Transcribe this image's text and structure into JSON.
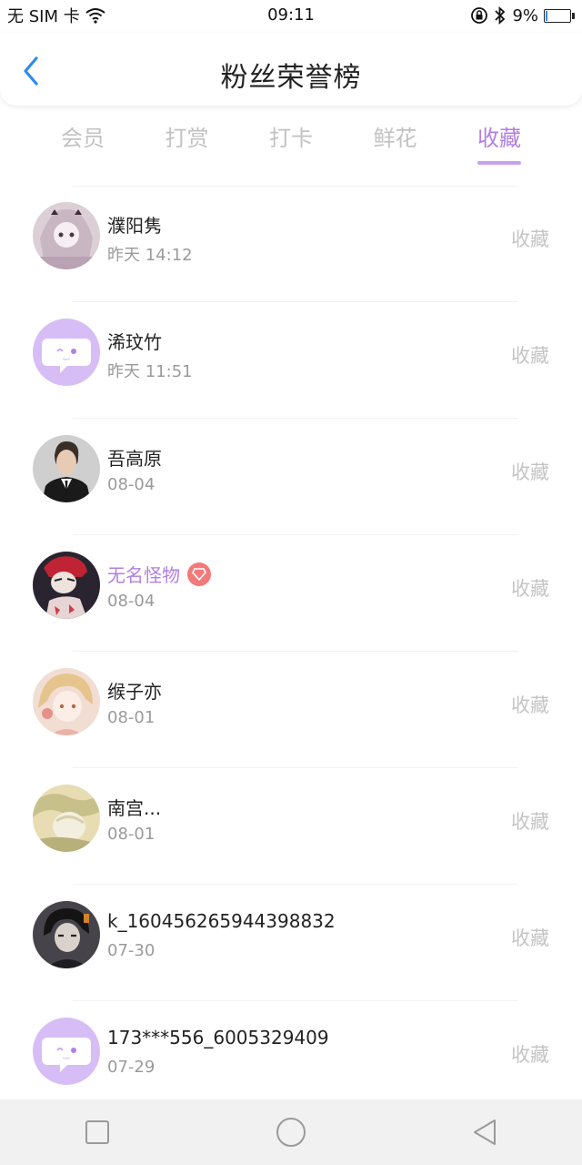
{
  "status_bar": {
    "carrier": "无 SIM 卡",
    "time": "09:11",
    "battery": "9%",
    "battery_level": 0.09,
    "icons": [
      "wifi-icon",
      "lock-rotation-icon",
      "bluetooth-icon",
      "battery-icon"
    ]
  },
  "header": {
    "title": "粉丝荣誉榜",
    "back_icon": "chevron-left-icon",
    "accent_color": "#2d8cf0"
  },
  "tabs": [
    {
      "label": "会员",
      "active": false
    },
    {
      "label": "打赏",
      "active": false
    },
    {
      "label": "打卡",
      "active": false
    },
    {
      "label": "鲜花",
      "active": false
    },
    {
      "label": "收藏",
      "active": true
    }
  ],
  "theme": {
    "active_color": "#b27fe0",
    "inactive_color": "#c2c2c2",
    "vip_badge_color": "#f27a7a"
  },
  "fans": [
    {
      "name": "濮阳隽",
      "time": "昨天 14:12",
      "action": "收藏",
      "vip": false,
      "avatar": "anime-girl-avatar"
    },
    {
      "name": "浠玟竹",
      "time": "昨天 11:51",
      "action": "收藏",
      "vip": false,
      "avatar": "default-chat-avatar"
    },
    {
      "name": "吾高原",
      "time": "08-04",
      "action": "收藏",
      "vip": false,
      "avatar": "man-suit-avatar"
    },
    {
      "name": "无名怪物",
      "time": "08-04",
      "action": "收藏",
      "vip": true,
      "avatar": "masked-person-avatar"
    },
    {
      "name": "缑子亦",
      "time": "08-01",
      "action": "收藏",
      "vip": false,
      "avatar": "anime-blonde-avatar"
    },
    {
      "name": "南宫...",
      "time": "08-01",
      "action": "收藏",
      "vip": false,
      "avatar": "pale-anime-avatar"
    },
    {
      "name": "k_160456265944398832",
      "time": "07-30",
      "action": "收藏",
      "vip": false,
      "avatar": "dark-anime-avatar"
    },
    {
      "name": "173***556_6005329409",
      "time": "07-29",
      "action": "收藏",
      "vip": false,
      "avatar": "default-chat-avatar"
    }
  ],
  "nav_bar": {
    "buttons": [
      "recent-apps-icon",
      "home-icon",
      "back-icon"
    ]
  }
}
